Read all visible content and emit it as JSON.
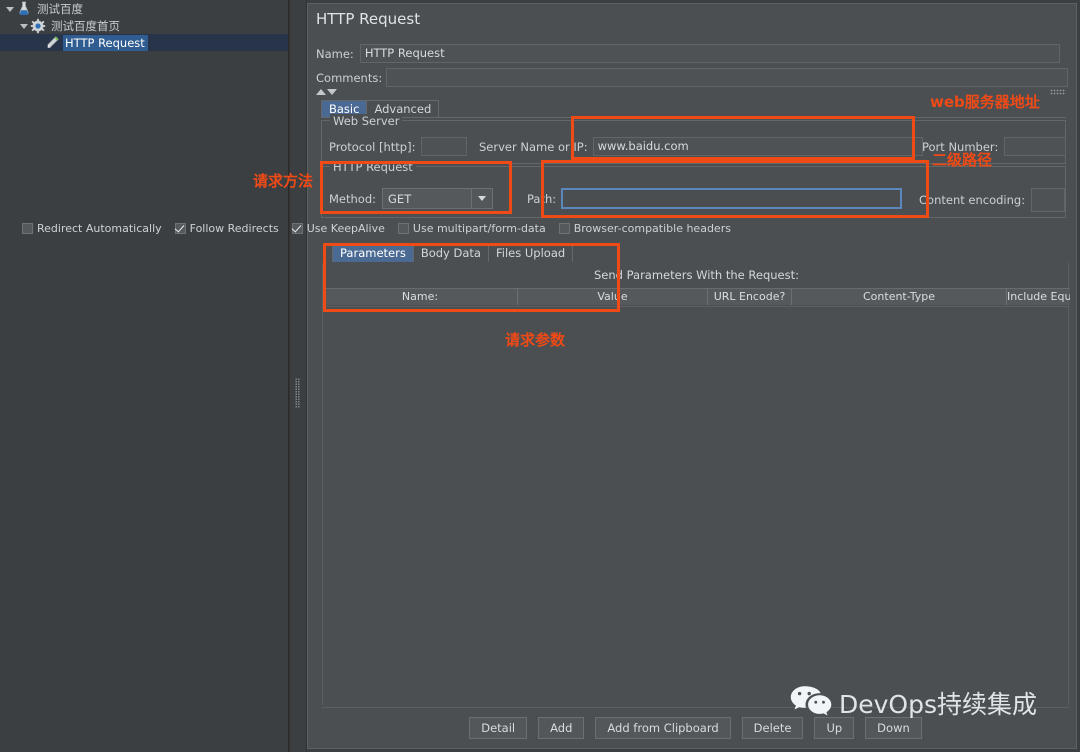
{
  "tree": {
    "items": [
      {
        "label": "测试百度",
        "icon": "test-plan-icon",
        "indent": 0,
        "selected": false,
        "expanded": true
      },
      {
        "label": "测试百度首页",
        "icon": "thread-group-icon",
        "indent": 1,
        "selected": false,
        "expanded": true
      },
      {
        "label": "HTTP Request",
        "icon": "http-sampler-icon",
        "indent": 2,
        "selected": true,
        "expanded": false
      }
    ]
  },
  "panel": {
    "title": "HTTP Request",
    "name_label": "Name:",
    "name_value": "HTTP Request",
    "comments_label": "Comments:",
    "comments_value": "",
    "tabs": [
      {
        "label": "Basic",
        "active": true
      },
      {
        "label": "Advanced",
        "active": false
      }
    ]
  },
  "web_server": {
    "group_title": "Web Server",
    "protocol_label": "Protocol [http]:",
    "protocol_value": "",
    "server_label": "Server Name or IP:",
    "server_value": "www.baidu.com",
    "port_label": "Port Number:",
    "port_value": ""
  },
  "http_request": {
    "group_title": "HTTP Request",
    "method_label": "Method:",
    "method_value": "GET",
    "path_label": "Path:",
    "path_value": "",
    "encoding_label": "Content encoding:",
    "encoding_value": ""
  },
  "options": [
    {
      "label": "Redirect Automatically",
      "checked": false
    },
    {
      "label": "Follow Redirects",
      "checked": true
    },
    {
      "label": "Use KeepAlive",
      "checked": true
    },
    {
      "label": "Use multipart/form-data",
      "checked": false
    },
    {
      "label": "Browser-compatible headers",
      "checked": false
    }
  ],
  "param_tabs": [
    {
      "label": "Parameters",
      "active": true
    },
    {
      "label": "Body Data",
      "active": false
    },
    {
      "label": "Files Upload",
      "active": false
    }
  ],
  "params_table": {
    "caption": "Send Parameters With the Request:",
    "columns": [
      "Name:",
      "Value",
      "URL Encode?",
      "Content-Type",
      "Include Equals?"
    ],
    "rows": []
  },
  "buttons": [
    {
      "label": "Detail"
    },
    {
      "label": "Add"
    },
    {
      "label": "Add from Clipboard"
    },
    {
      "label": "Delete"
    },
    {
      "label": "Up"
    },
    {
      "label": "Down"
    }
  ],
  "annotations": {
    "web_server_address": "web服务器地址",
    "secondary_path": "二级路径",
    "request_method": "请求方法",
    "request_params": "请求参数",
    "accent_color": "#f04a16"
  },
  "watermark": {
    "text": "DevOps持续集成",
    "icon": "wechat-icon"
  }
}
